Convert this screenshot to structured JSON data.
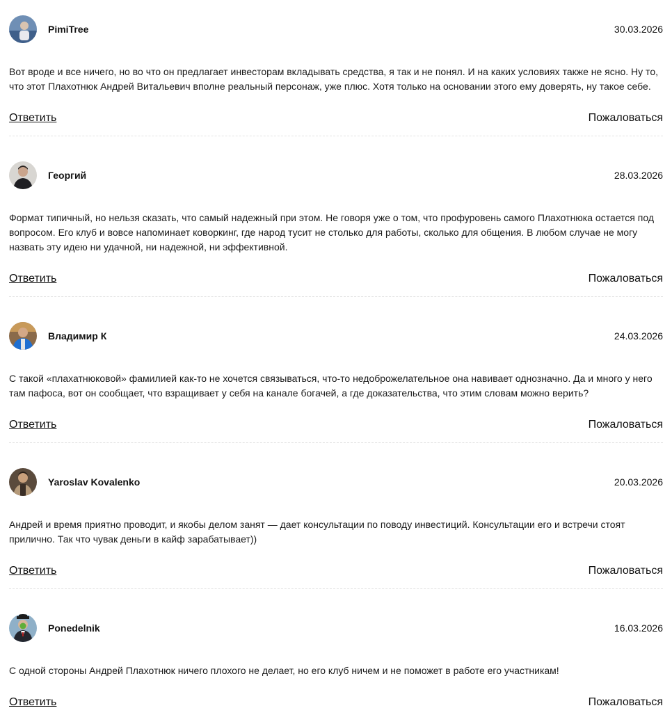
{
  "comments": [
    {
      "author": "PimiTree",
      "date": "30.03.2026",
      "text": "Вот вроде и все ничего, но во что он предлагает инвесторам вкладывать средства, я так и не понял. И на каких условиях также не ясно. Ну то, что этот Плахотнюк Андрей Витальевич вполне реальный персонаж, уже плюс. Хотя только на основании этого ему доверять, ну такое себе.",
      "reply_label": "Ответить",
      "report_label": "Пожаловаться"
    },
    {
      "author": "Георгий",
      "date": "28.03.2026",
      "text": "Формат типичный, но нельзя сказать, что самый надежный при этом. Не говоря уже о том, что профуровень самого Плахотнюка остается под вопросом. Его клуб и вовсе напоминает коворкинг, где народ тусит не столько для работы, сколько для общения. В любом случае не могу назвать эту идею ни удачной, ни надежной, ни эффективной.",
      "reply_label": "Ответить",
      "report_label": "Пожаловаться"
    },
    {
      "author": "Владимир К",
      "date": "24.03.2026",
      "text": "С такой «плахатнюковой» фамилией как-то не хочется связываться, что-то недоброжелательное она навивает однозначно. Да и много у него там пафоса, вот он сообщает, что взращивает у себя на канале богачей, а где доказательства, что этим словам можно верить?",
      "reply_label": "Ответить",
      "report_label": "Пожаловаться"
    },
    {
      "author": "Yaroslav Kovalenko",
      "date": "20.03.2026",
      "text": "Андрей и время приятно проводит, и якобы делом занят — дает консультации по поводу инвестиций. Консультации его и встречи стоят прилично. Так что чувак деньги в кайф зарабатывает))",
      "reply_label": "Ответить",
      "report_label": "Пожаловаться"
    },
    {
      "author": "Ponedelnik",
      "date": "16.03.2026",
      "text": "С одной стороны Андрей Плахотнюк ничего плохого не делает, но его клуб ничем и не поможет в работе его участникам!",
      "reply_label": "Ответить",
      "report_label": "Пожаловаться"
    }
  ]
}
